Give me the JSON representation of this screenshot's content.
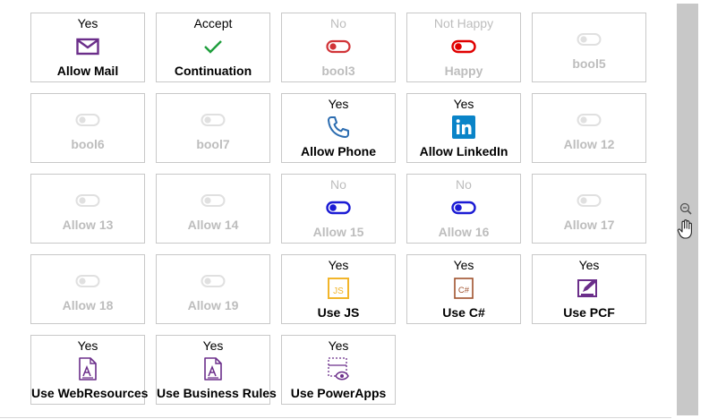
{
  "tiles": [
    {
      "status": "Yes",
      "label": "Allow Mail",
      "icon": "mail-icon",
      "state": "on"
    },
    {
      "status": "Accept",
      "label": "Continuation",
      "icon": "checkmark-icon",
      "state": "on"
    },
    {
      "status": "No",
      "label": "bool3",
      "icon": "toggle-red-icon",
      "state": "off"
    },
    {
      "status": "Not Happy",
      "label": "Happy",
      "icon": "toggle-red-filled-icon",
      "state": "off"
    },
    {
      "status": "",
      "label": "bool5",
      "icon": "toggle-gray-icon",
      "state": "empty"
    },
    {
      "status": "",
      "label": "bool6",
      "icon": "toggle-gray-icon",
      "state": "empty"
    },
    {
      "status": "",
      "label": "bool7",
      "icon": "toggle-gray-icon",
      "state": "empty"
    },
    {
      "status": "Yes",
      "label": "Allow Phone",
      "icon": "phone-icon",
      "state": "on"
    },
    {
      "status": "Yes",
      "label": "Allow LinkedIn",
      "icon": "linkedin-icon",
      "state": "on"
    },
    {
      "status": "",
      "label": "Allow 12",
      "icon": "toggle-gray-icon",
      "state": "empty"
    },
    {
      "status": "",
      "label": "Allow 13",
      "icon": "toggle-gray-icon",
      "state": "empty"
    },
    {
      "status": "",
      "label": "Allow 14",
      "icon": "toggle-gray-icon",
      "state": "empty"
    },
    {
      "status": "No",
      "label": "Allow 15",
      "icon": "toggle-blue-icon",
      "state": "off"
    },
    {
      "status": "No",
      "label": "Allow 16",
      "icon": "toggle-blue-icon",
      "state": "off"
    },
    {
      "status": "",
      "label": "Allow 17",
      "icon": "toggle-gray-icon",
      "state": "empty"
    },
    {
      "status": "",
      "label": "Allow 18",
      "icon": "toggle-gray-icon",
      "state": "empty"
    },
    {
      "status": "",
      "label": "Allow 19",
      "icon": "toggle-gray-icon",
      "state": "empty"
    },
    {
      "status": "Yes",
      "label": "Use JS",
      "icon": "js-file-icon",
      "state": "on"
    },
    {
      "status": "Yes",
      "label": "Use C#",
      "icon": "csharp-file-icon",
      "state": "on"
    },
    {
      "status": "Yes",
      "label": "Use PCF",
      "icon": "pcf-edit-icon",
      "state": "on"
    },
    {
      "status": "Yes",
      "label": "Use WebResources",
      "icon": "web-resource-file-icon",
      "state": "on"
    },
    {
      "status": "Yes",
      "label": "Use Business Rules",
      "icon": "business-rule-file-icon",
      "state": "on"
    },
    {
      "status": "Yes",
      "label": "Use PowerApps",
      "icon": "powerapps-form-icon",
      "state": "on"
    }
  ],
  "colors": {
    "mail": "#6b2e8a",
    "check": "#1e9e3c",
    "toggleRed": "#d13438",
    "toggleBlue": "#1b1bd4",
    "toggleGray": "#e0e0e0",
    "phone": "#2b6cb0",
    "linkedin": "#0a84c8",
    "js": "#f2b52a",
    "csharp": "#a0522d",
    "purple": "#6b2e8a"
  }
}
